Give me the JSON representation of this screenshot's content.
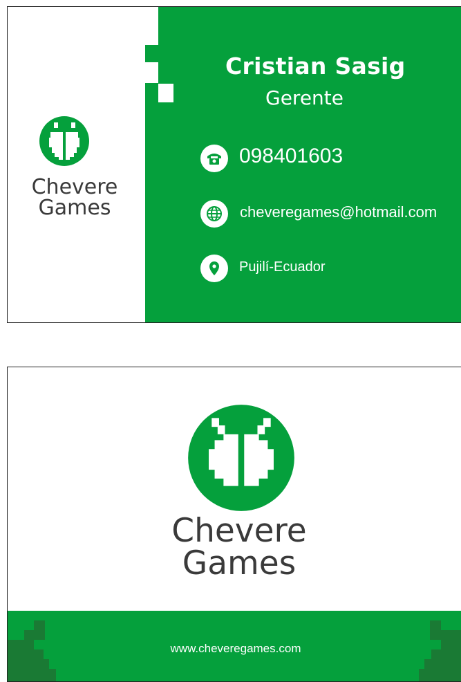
{
  "front": {
    "name": "Cristian Sasig",
    "role": "Gerente",
    "phone": "098401603",
    "email": "cheveregames@hotmail.com",
    "location": "Pujilí-Ecuador",
    "logo_line1": "Chevere",
    "logo_line2": "Games"
  },
  "back": {
    "logo_line1": "Chevere",
    "logo_line2": "Games",
    "website": "www.cheveregames.com"
  },
  "colors": {
    "brand_green": "#05a03c",
    "dark_green": "#1a7a34",
    "logo_text": "#3a3a3a",
    "background": "#ffffff"
  },
  "icons": [
    "phone-icon",
    "globe-icon",
    "location-pin-icon",
    "chevere-games-logo"
  ]
}
